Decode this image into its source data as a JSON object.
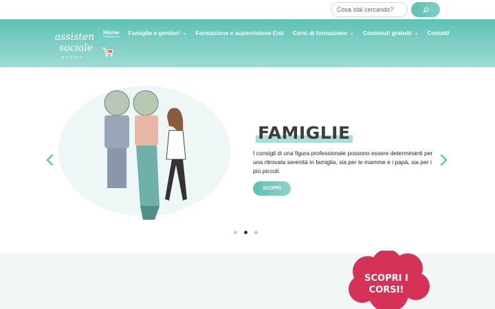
{
  "search": {
    "placeholder": "Cosa stai cercando?"
  },
  "logo": {
    "line1": "assistente",
    "line2": "sociale",
    "line3": "privato"
  },
  "nav": {
    "items": [
      {
        "label": "Home",
        "dropdown": false,
        "active": true
      },
      {
        "label": "Famiglie e genitori",
        "dropdown": true
      },
      {
        "label": "Formazione e supervisione Enti",
        "dropdown": false
      },
      {
        "label": "Corsi di formazione",
        "dropdown": true
      },
      {
        "label": "Contenuti gratuiti",
        "dropdown": true
      },
      {
        "label": "Contatti",
        "dropdown": false
      }
    ]
  },
  "slide": {
    "title": "FAMIGLIE",
    "text": "I consigli di una figura professionale possono essere determinanti per una ritrovata serenità in famiglia, sia per le mamme e i papà, sia per i più piccoli.",
    "button": "SCOPRI"
  },
  "promo": {
    "line1": "SCOPRI I",
    "line2": "CORSI!"
  },
  "colors": {
    "accent": "#5ec2b5",
    "promo": "#d63258"
  }
}
